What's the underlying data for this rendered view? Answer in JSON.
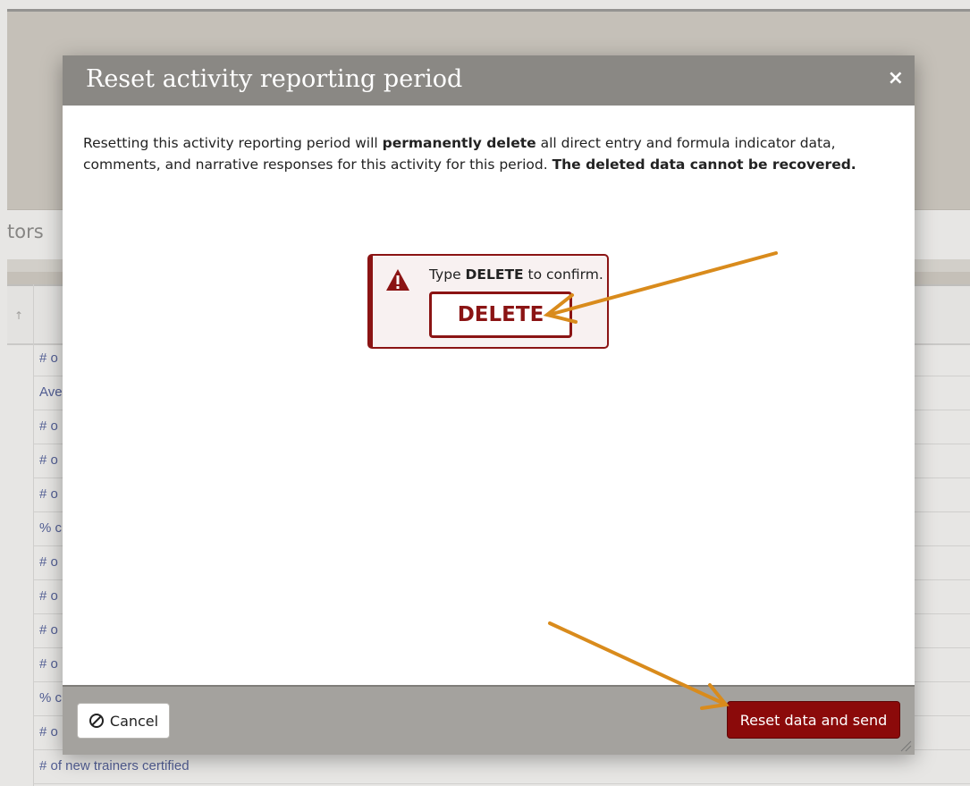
{
  "background": {
    "section_heading": "tors",
    "table_rows": [
      "# o",
      "Ave",
      "# o",
      "# o",
      "# o",
      "% c",
      "# o",
      "# o",
      "# o",
      "# o",
      "% c",
      "# o",
      "# of new trainers certified"
    ]
  },
  "modal": {
    "title": "Reset activity reporting period",
    "close_icon": "×",
    "body": {
      "part1": "Resetting this activity reporting period will ",
      "bold1": "permanently delete",
      "part2": " all direct entry and formula indicator data, comments, and narrative responses for this activity for this period. ",
      "bold2": "The deleted data cannot be recovered."
    },
    "confirm": {
      "label_prefix": "Type ",
      "label_keyword": "DELETE",
      "label_suffix": " to confirm.",
      "input_value": "DELETE",
      "icon": "warning-icon"
    },
    "footer": {
      "cancel_label": "Cancel",
      "reset_label": "Reset data and send"
    }
  },
  "colors": {
    "header_bg": "#8a8884",
    "danger": "#8b0a0a",
    "annotation_arrow": "#d98b1c",
    "link_text": "#4a5a9e"
  }
}
